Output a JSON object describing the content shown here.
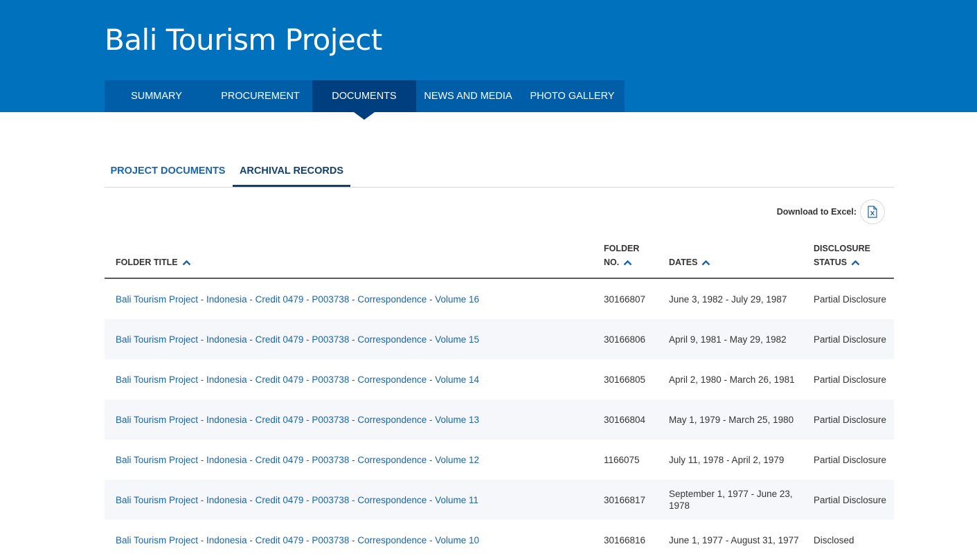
{
  "header": {
    "title": "Bali Tourism Project"
  },
  "nav": {
    "items": [
      {
        "label": "SUMMARY"
      },
      {
        "label": "PROCUREMENT"
      },
      {
        "label": "DOCUMENTS"
      },
      {
        "label": "NEWS AND MEDIA"
      },
      {
        "label": "PHOTO GALLERY"
      }
    ],
    "active": "DOCUMENTS"
  },
  "sub_tabs": {
    "items": [
      {
        "label": "PROJECT DOCUMENTS"
      },
      {
        "label": "ARCHIVAL RECORDS"
      }
    ],
    "active": "ARCHIVAL RECORDS"
  },
  "download": {
    "label": "Download to Excel:",
    "icon": "excel-file-icon"
  },
  "table": {
    "headers": {
      "title": "FOLDER TITLE",
      "folder_line1": "FOLDER",
      "folder_line2": "NO.",
      "dates": "DATES",
      "status_line1": "DISCLOSURE",
      "status_line2": "STATUS"
    },
    "rows": [
      {
        "title": "Bali Tourism Project - Indonesia - Credit 0479 - P003738 - Correspondence - Volume 16",
        "folder": "30166807",
        "dates": "June 3, 1982 - July 29, 1987",
        "status": "Partial Disclosure"
      },
      {
        "title": "Bali Tourism Project - Indonesia - Credit 0479 - P003738 - Correspondence - Volume 15",
        "folder": "30166806",
        "dates": "April 9, 1981 - May 29, 1982",
        "status": "Partial Disclosure"
      },
      {
        "title": "Bali Tourism Project - Indonesia - Credit 0479 - P003738 - Correspondence - Volume 14",
        "folder": "30166805",
        "dates": "April 2, 1980 - March 26, 1981",
        "status": "Partial Disclosure"
      },
      {
        "title": "Bali Tourism Project - Indonesia - Credit 0479 - P003738 - Correspondence - Volume 13",
        "folder": "30166804",
        "dates": "May 1, 1979 - March 25, 1980",
        "status": "Partial Disclosure"
      },
      {
        "title": "Bali Tourism Project - Indonesia - Credit 0479 - P003738 - Correspondence - Volume 12",
        "folder": "1166075",
        "dates": "July 11, 1978 - April 2, 1979",
        "status": "Partial Disclosure"
      },
      {
        "title": "Bali Tourism Project - Indonesia - Credit 0479 - P003738 - Correspondence - Volume 11",
        "folder": "30166817",
        "dates": "September 1, 1977 - June 23, 1978",
        "status": "Partial Disclosure"
      },
      {
        "title": "Bali Tourism Project - Indonesia - Credit 0479 - P003738 - Correspondence - Volume 10",
        "folder": "30166816",
        "dates": "June 1, 1977 - August 31, 1977",
        "status": "Disclosed"
      }
    ]
  },
  "colors": {
    "header_bg": "#0071bc",
    "nav_bg": "#005ea8",
    "nav_active": "#003f7f",
    "link": "#1a64a8"
  }
}
